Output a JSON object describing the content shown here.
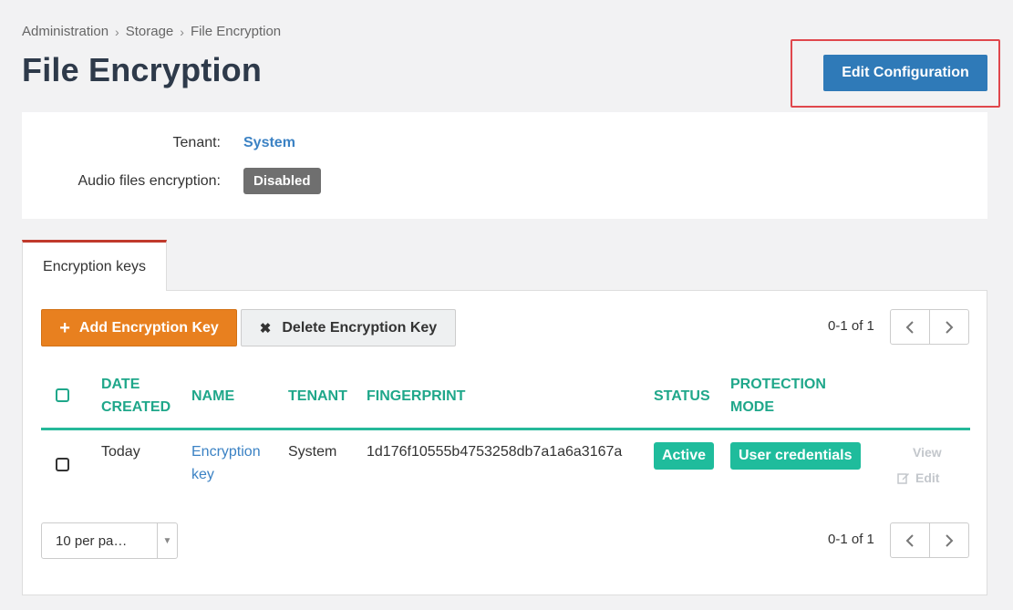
{
  "breadcrumb": [
    "Administration",
    "Storage",
    "File Encryption"
  ],
  "page_title": "File Encryption",
  "edit_config_label": "Edit Configuration",
  "info": {
    "tenant_label": "Tenant:",
    "tenant_value": "System",
    "audio_label": "Audio files encryption:",
    "audio_value": "Disabled"
  },
  "tab_label": "Encryption keys",
  "toolbar": {
    "add_label": "Add Encryption Key",
    "delete_label": "Delete Encryption Key"
  },
  "pagination": {
    "top_text": "0-1 of 1",
    "bottom_text": "0-1 of 1"
  },
  "columns": {
    "date_line1": "DATE",
    "date_line2": "CREATED",
    "name": "NAME",
    "tenant": "TENANT",
    "fingerprint": "FINGERPRINT",
    "status": "STATUS",
    "protection_line1": "PROTECTION",
    "protection_line2": "MODE"
  },
  "rows": [
    {
      "date_created": "Today",
      "name_line1": "Encryption",
      "name_line2": "key",
      "tenant": "System",
      "fingerprint": "1d176f10555b4753258db7a1a6a3167a",
      "status": "Active",
      "protection_mode": "User credentials",
      "view_label": "View",
      "edit_label": "Edit"
    }
  ],
  "per_page_value": "10 per pa…",
  "colors": {
    "primary_blue": "#2f7ab8",
    "accent_orange": "#e8801f",
    "teal": "#1fa78a",
    "badge_green": "#1fbc9c",
    "highlight_red": "#e0474c"
  }
}
